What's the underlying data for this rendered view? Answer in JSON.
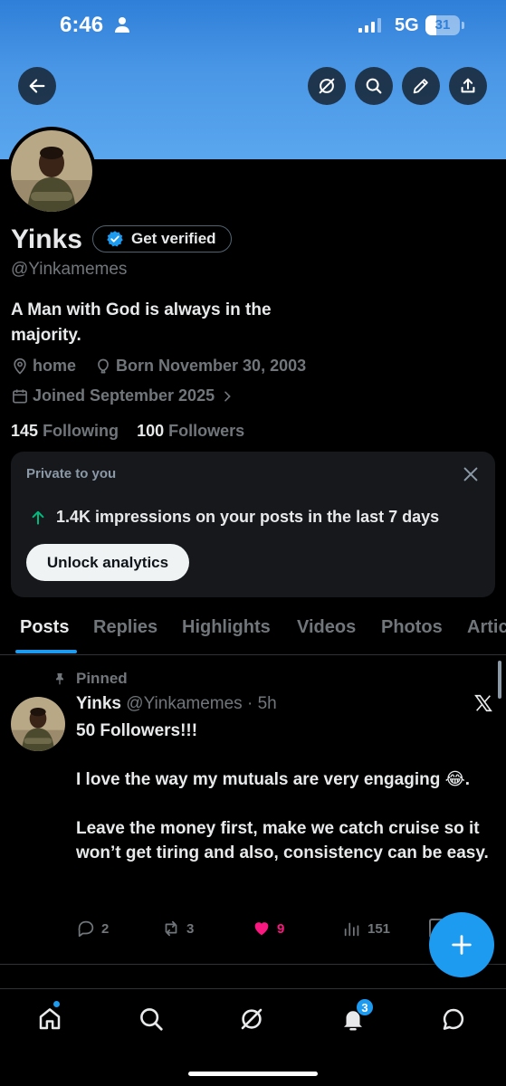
{
  "status_bar": {
    "time": "6:46",
    "network": "5G",
    "battery": "31",
    "battery_level": 0.31
  },
  "header": {
    "back_icon": "arrow-left-icon",
    "grok_icon": "grok-icon",
    "search_icon": "search-icon",
    "edit_icon": "pencil-icon",
    "share_icon": "share-icon"
  },
  "profile": {
    "name": "Yinks",
    "verify_label": "Get verified",
    "handle": "@Yinkamemes",
    "bio": "A Man with God is always in the majority.",
    "location": "home",
    "birthday": "Born November 30, 2003",
    "joined": "Joined September 2025",
    "following_count": "145",
    "following_label": "Following",
    "followers_count": "100",
    "followers_label": "Followers"
  },
  "private_card": {
    "title": "Private to you",
    "impressions_text": "1.4K impressions on your posts in the last 7 days",
    "button_label": "Unlock analytics"
  },
  "tabs": [
    {
      "label": "Posts",
      "active": true
    },
    {
      "label": "Replies"
    },
    {
      "label": "Highlights"
    },
    {
      "label": "Videos"
    },
    {
      "label": "Photos"
    },
    {
      "label": "Articles"
    }
  ],
  "post": {
    "pinned_label": "Pinned",
    "author": "Yinks",
    "handle_time": "@Yinkamemes · 5h",
    "lines": [
      "50 Followers!!!",
      "",
      "I love the way my mutuals are very engaging 😂.",
      "",
      "Leave the money first, make we catch cruise so it won’t get tiring and also, consistency can be easy."
    ],
    "replies": "2",
    "reposts": "3",
    "likes": "9",
    "views": "151"
  },
  "bottom_nav": {
    "notifications_badge": "3"
  },
  "colors": {
    "accent": "#1d9bf0",
    "like": "#f91880",
    "banner": "#4a97e6",
    "card_bg": "#16181c"
  }
}
